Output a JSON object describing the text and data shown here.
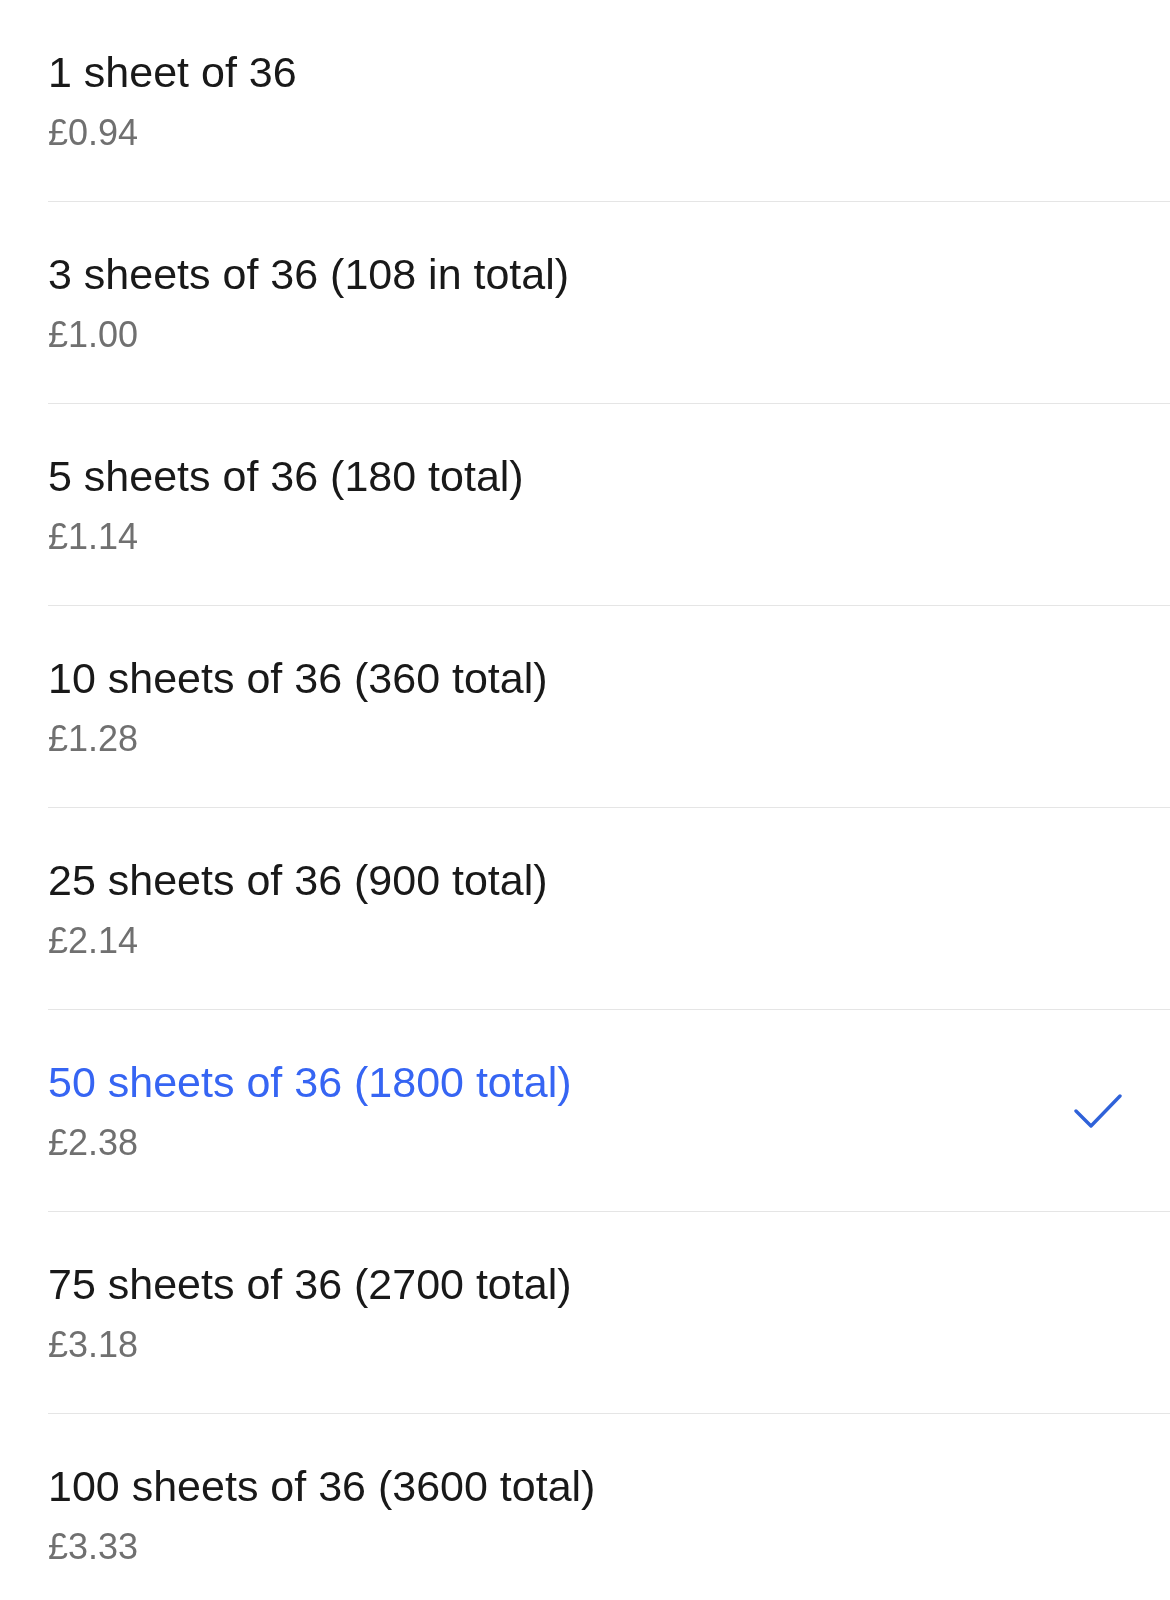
{
  "options": [
    {
      "label": "1 sheet of 36",
      "price": "£0.94",
      "selected": false
    },
    {
      "label": "3 sheets of 36 (108 in total)",
      "price": "£1.00",
      "selected": false
    },
    {
      "label": "5 sheets of 36 (180 total)",
      "price": "£1.14",
      "selected": false
    },
    {
      "label": "10 sheets of 36 (360 total)",
      "price": "£1.28",
      "selected": false
    },
    {
      "label": "25 sheets of 36 (900 total)",
      "price": "£2.14",
      "selected": false
    },
    {
      "label": "50 sheets of 36 (1800 total)",
      "price": "£2.38",
      "selected": true
    },
    {
      "label": "75 sheets of 36 (2700 total)",
      "price": "£3.18",
      "selected": false
    },
    {
      "label": "100 sheets of 36 (3600 total)",
      "price": "£3.33",
      "selected": false
    }
  ]
}
